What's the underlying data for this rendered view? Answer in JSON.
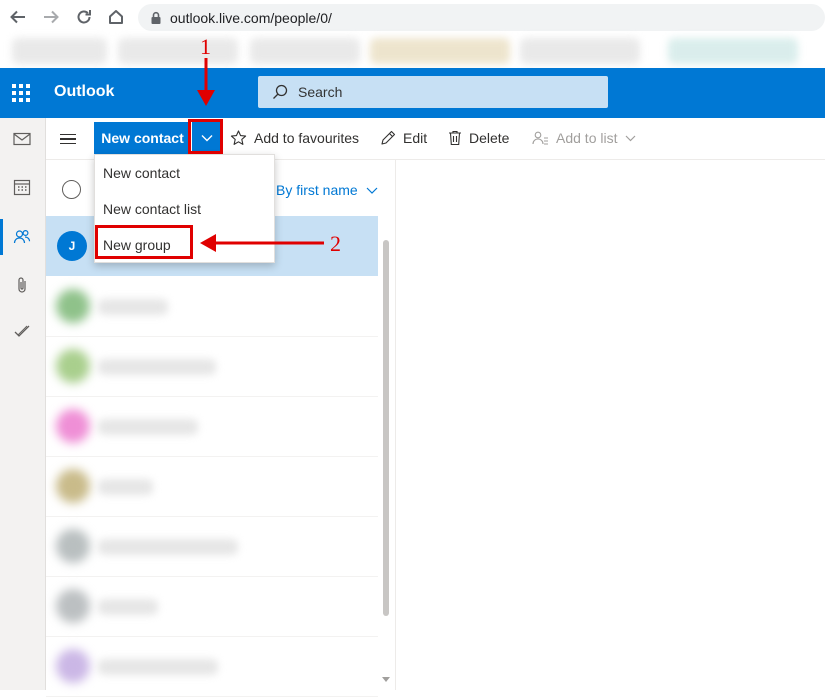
{
  "browser": {
    "url": "outlook.live.com/people/0/"
  },
  "header": {
    "app_name": "Outlook",
    "search_placeholder": "Search"
  },
  "commandbar": {
    "new_contact": "New contact",
    "add_to_favourites": "Add to favourites",
    "edit": "Edit",
    "delete": "Delete",
    "add_to_list": "Add to list"
  },
  "list": {
    "sort_label": "By first name",
    "selected_avatar_initial": "J"
  },
  "dropdown": {
    "items": [
      "New contact",
      "New contact list",
      "New group"
    ]
  },
  "annotations": {
    "step1": "1",
    "step2": "2"
  },
  "colors": {
    "brand": "#0078d4",
    "annotation": "#e00000",
    "selected_row": "#c7e0f4"
  }
}
